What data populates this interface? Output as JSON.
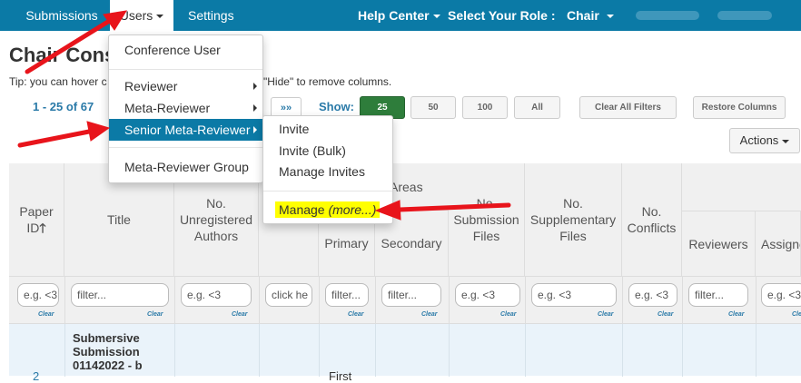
{
  "nav": {
    "submissions": "Submissions",
    "users": "Users",
    "settings": "Settings",
    "help_center": "Help Center",
    "select_role": "Select Your Role :",
    "role": "Chair"
  },
  "page": {
    "title": "Chair Cons",
    "tip_prefix": "Tip: you can hover c",
    "tip_suffix": "\"Hide\" to remove columns."
  },
  "pager": {
    "range": "1 - 25 of 67",
    "last_label": "»»",
    "show_label": "Show:",
    "sizes": [
      "25",
      "50",
      "100",
      "All"
    ],
    "selected_size": "25",
    "clear_filters": "Clear All Filters",
    "restore_columns": "Restore Columns",
    "actions": "Actions"
  },
  "users_menu": {
    "items": [
      "Conference User",
      "Reviewer",
      "Meta-Reviewer",
      "Senior Meta-Reviewer",
      "Meta-Reviewer Group"
    ],
    "highlighted": "Senior Meta-Reviewer"
  },
  "submenu": {
    "items": [
      "Invite",
      "Invite (Bulk)",
      "Manage Invites"
    ],
    "manage": "Manage",
    "more": "(more...)"
  },
  "table": {
    "columns": {
      "paper_id": "Paper ID",
      "title": "Title",
      "unregistered": "No. Unregistered Authors",
      "areas": "Areas",
      "primary": "Primary",
      "secondary": "Secondary",
      "submission_files": "No. Submission Files",
      "supplementary": "No. Supplementary Files",
      "conflicts": "No. Conflicts",
      "reviewers": "Reviewers",
      "assigned": "Assigne"
    },
    "filters": [
      "e.g. <3",
      "filter...",
      "e.g. <3",
      "click he",
      "filter...",
      "filter...",
      "e.g. <3",
      "e.g. <3",
      "e.g. <3",
      "filter...",
      "e.g. <3"
    ],
    "clear_label": "Clear",
    "first_row": {
      "title": "Submersive Submission 01142022 - b",
      "id_partial": "2",
      "primary_partial": "First"
    }
  },
  "colors": {
    "nav_bg": "#0b7aa6",
    "accent": "#2a7aa8",
    "selected_size": "#2e7d3b",
    "annotation_arrow": "#e8141b",
    "highlight": "#ffff00"
  }
}
